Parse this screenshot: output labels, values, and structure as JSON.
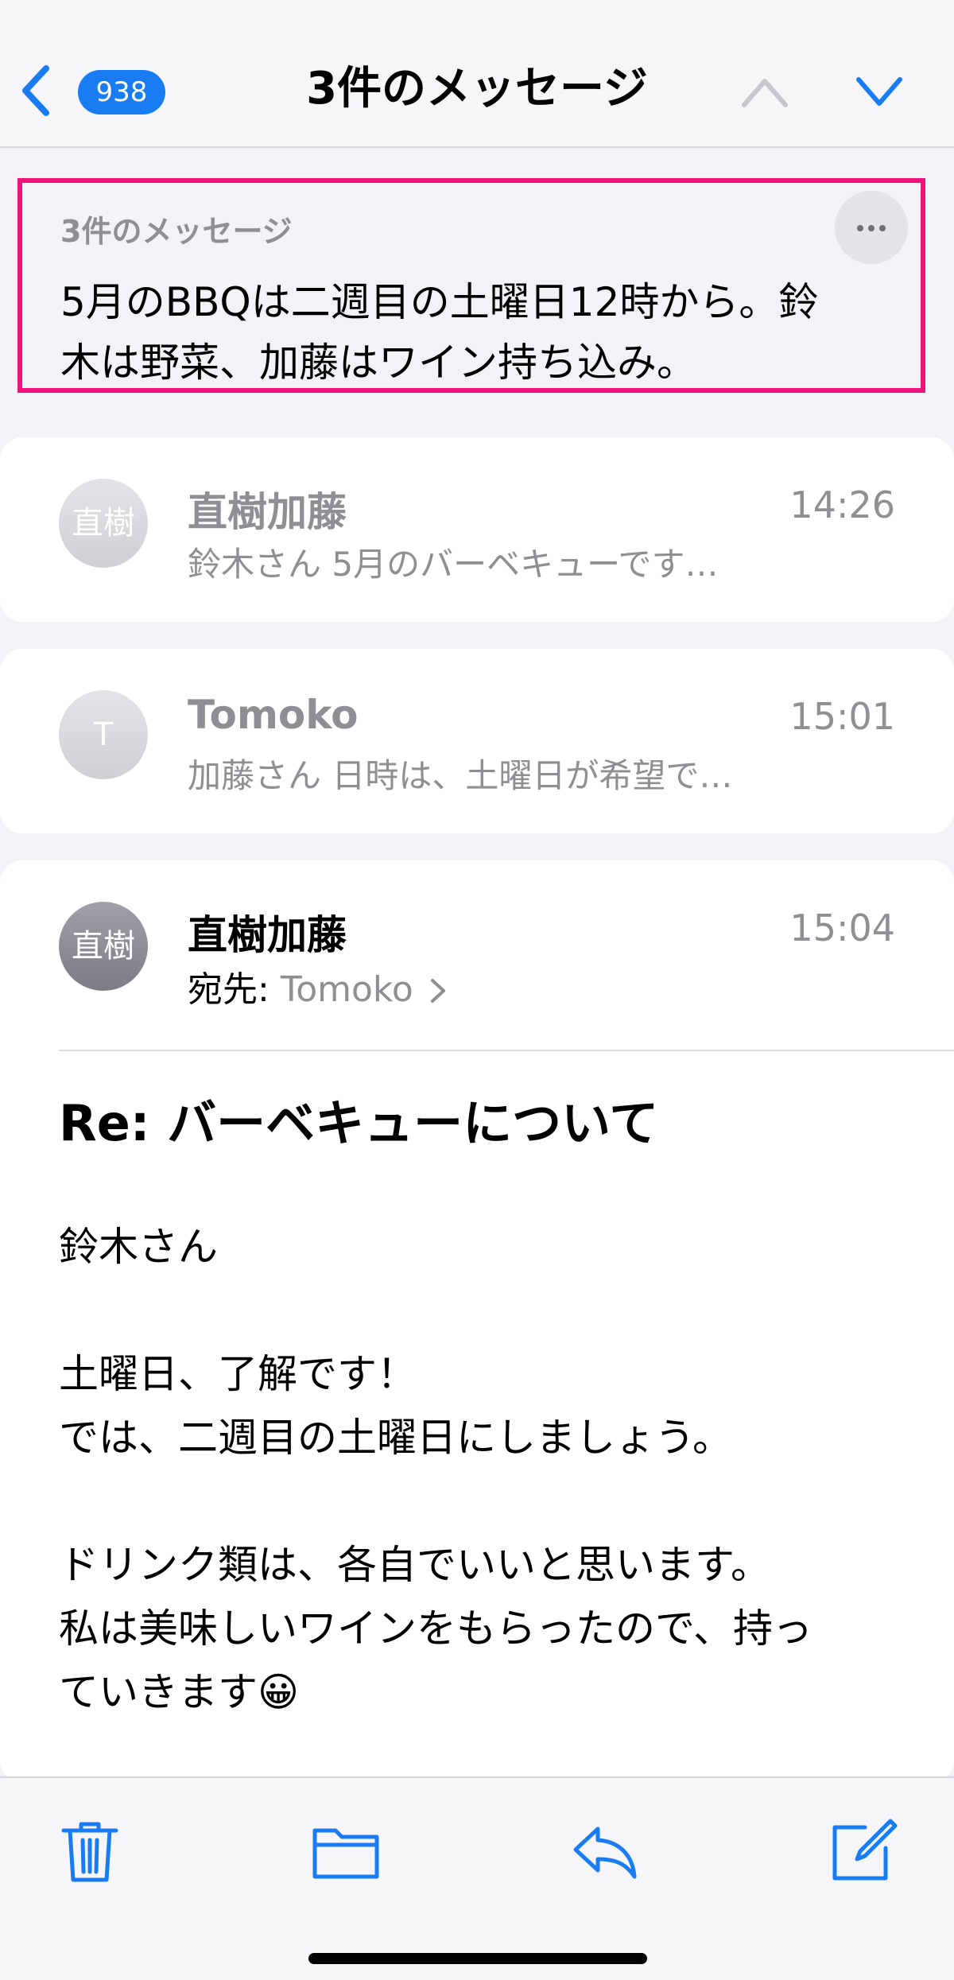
{
  "colors": {
    "accent": "#1a7cf3",
    "highlight_border": "#f0147a",
    "secondary_text": "#8e8e93"
  },
  "nav": {
    "badge_count": "938",
    "title": "3件のメッセージ",
    "icons": [
      "chevron-left-icon",
      "chevron-up-icon",
      "chevron-down-icon"
    ]
  },
  "summary": {
    "label": "3件のメッセージ",
    "text_line1": "5月のBBQは二週目の土曜日12時から。鈴",
    "text_line2": "木は野菜、加藤はワイン持ち込み。"
  },
  "messages": [
    {
      "avatar": "直樹",
      "sender": "直樹加藤",
      "time": "14:26",
      "preview": "鈴木さん 5月のバーベキューです…",
      "replied": true
    },
    {
      "avatar": "T",
      "sender": "Tomoko",
      "time": "15:01",
      "preview": "加藤さん 日時は、土曜日が希望で…"
    },
    {
      "avatar": "直樹",
      "sender": "直樹加藤",
      "time": "15:04",
      "to_label": "宛先:",
      "to_name": "Tomoko",
      "subject": "Re: バーベキューについて",
      "body": [
        "鈴木さん",
        "土曜日、了解です！",
        "では、二週目の土曜日にしましょう。",
        "ドリンク類は、各自でいいと思います。",
        "私は美味しいワインをもらったので、持っ",
        "ていきます😀"
      ]
    }
  ],
  "toolbar": {
    "icons": [
      "trash-icon",
      "folder-icon",
      "reply-icon",
      "compose-icon"
    ]
  }
}
